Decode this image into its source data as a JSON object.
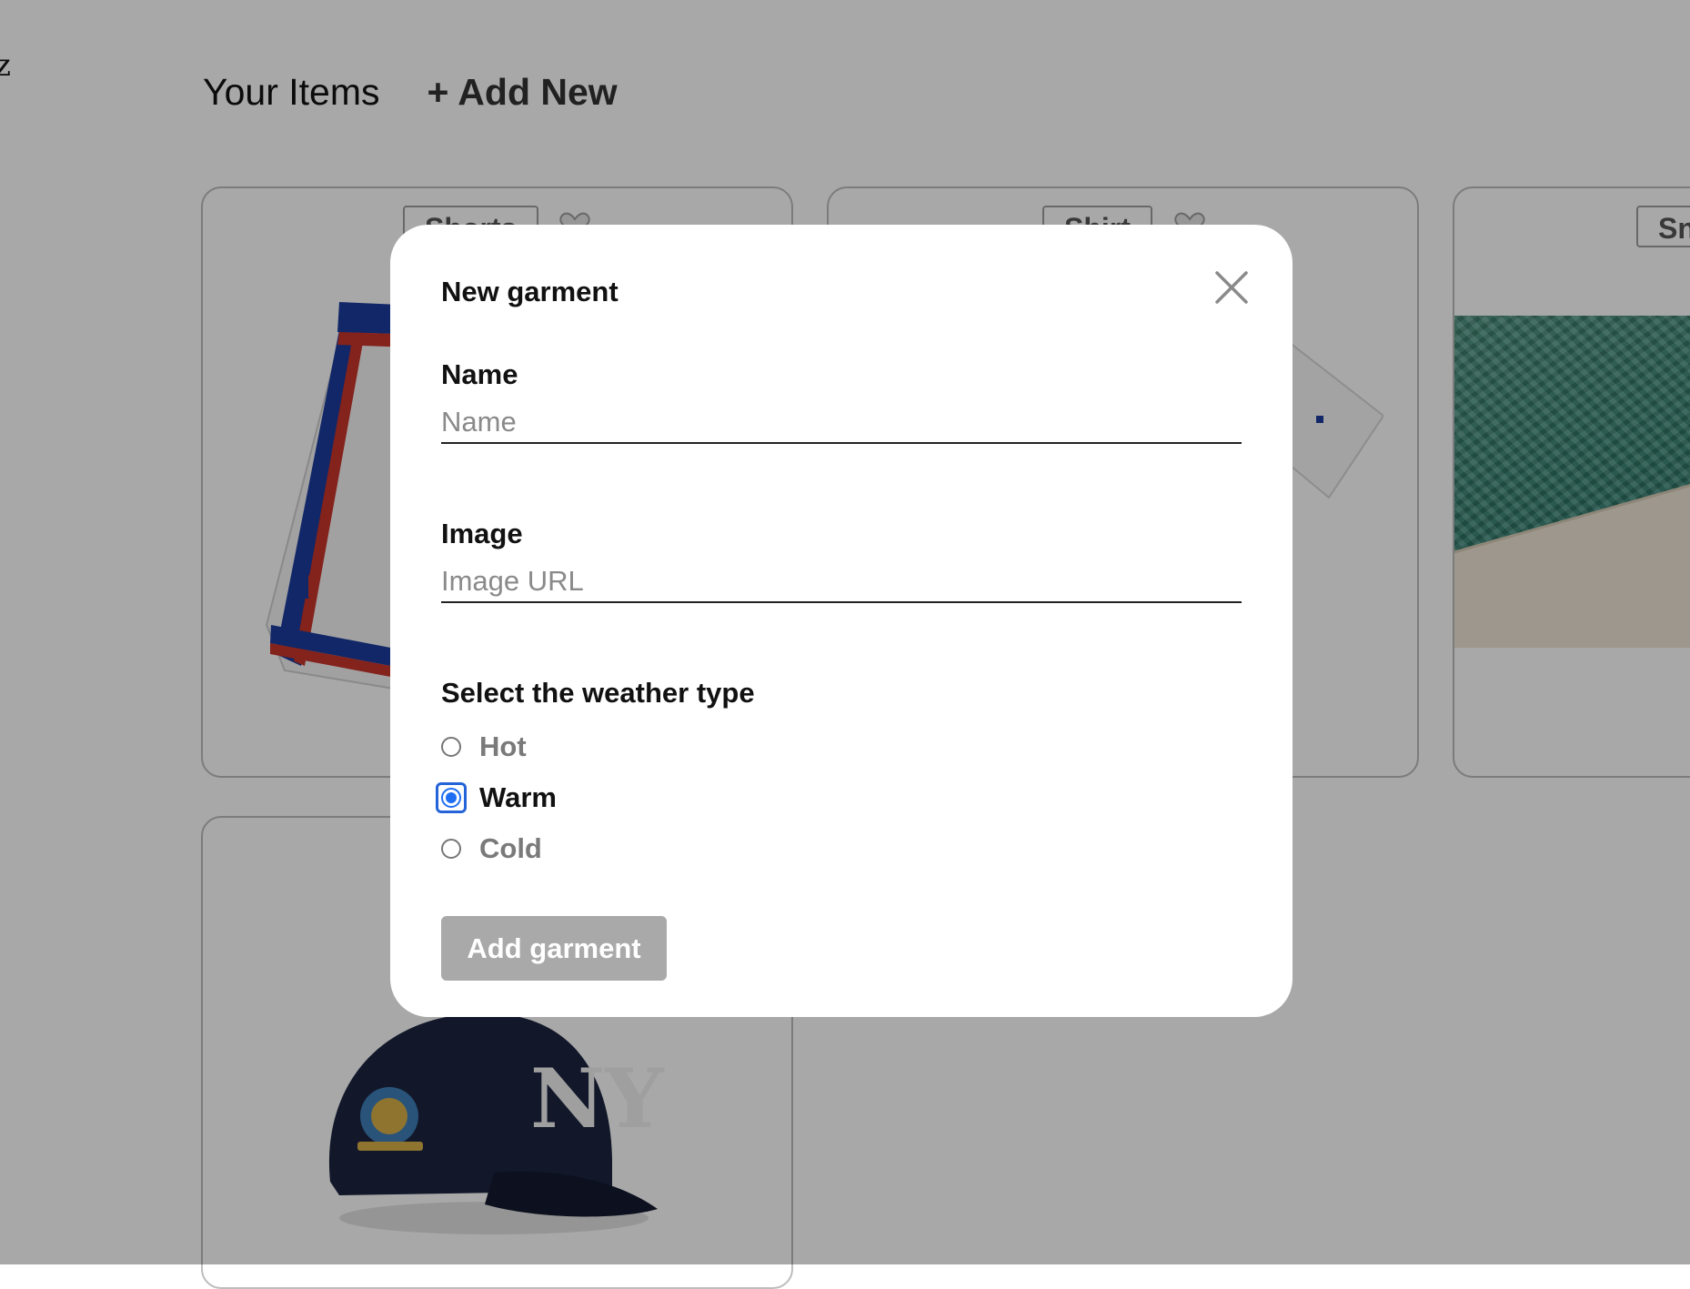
{
  "header": {
    "logo_fragment": "z",
    "title": "Your Items",
    "add_new": "+ Add New"
  },
  "cards": [
    {
      "tag": "Shorts",
      "image": "basketball-shorts"
    },
    {
      "tag": "Shirt",
      "image": "white-t-shirt"
    },
    {
      "tag": "Sn",
      "image": "pool-photo"
    },
    {
      "tag": "",
      "image": "navy-baseball-cap"
    }
  ],
  "modal": {
    "title": "New garment",
    "name_label": "Name",
    "name_placeholder": "Name",
    "name_value": "",
    "image_label": "Image",
    "image_placeholder": "Image URL",
    "image_value": "",
    "weather_label": "Select the weather type",
    "weather_options": [
      "Hot",
      "Warm",
      "Cold"
    ],
    "weather_selected": "Warm",
    "submit_label": "Add garment"
  },
  "colors": {
    "overlay": "#000000",
    "accent": "#1f6ef3",
    "button_disabled": "#a9a9a9"
  },
  "icons": {
    "close": "close-icon",
    "favorite": "heart-icon"
  }
}
